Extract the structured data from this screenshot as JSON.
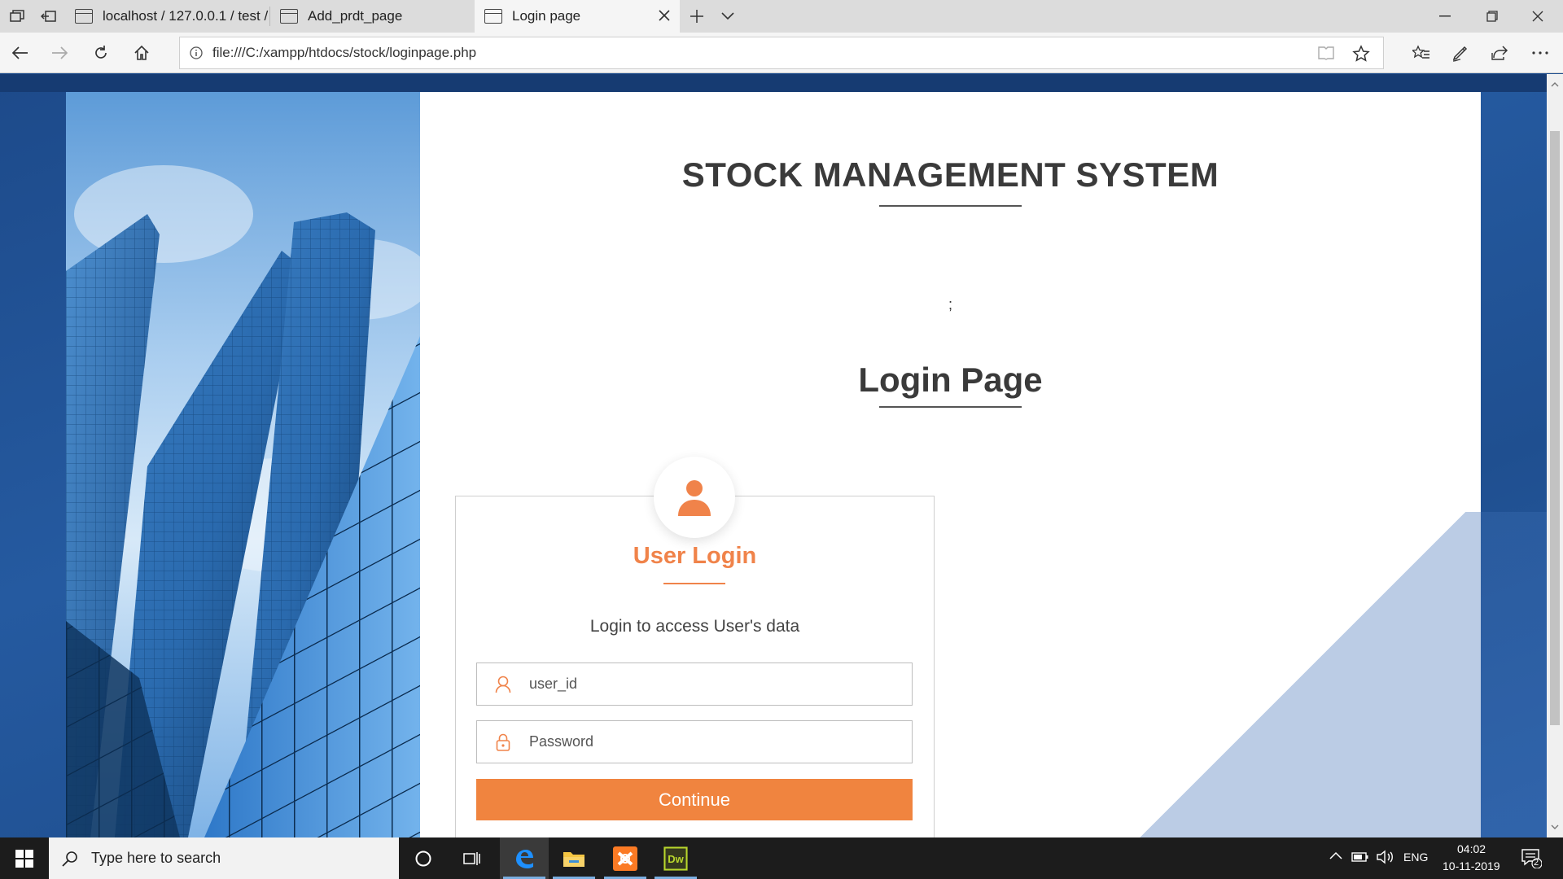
{
  "browser": {
    "tabs": [
      {
        "label": "localhost / 127.0.0.1 / test /"
      },
      {
        "label": "Add_prdt_page"
      },
      {
        "label": "Login page"
      }
    ],
    "url": "file:///C:/xampp/htdocs/stock/loginpage.php"
  },
  "page": {
    "site_title": "STOCK MANAGEMENT SYSTEM",
    "stray_text": ";",
    "heading": "Login Page",
    "login": {
      "title": "User Login",
      "subtitle": "Login to access User's data",
      "user_placeholder": "user_id",
      "password_placeholder": "Password",
      "submit_label": "Continue"
    }
  },
  "taskbar": {
    "search_placeholder": "Type here to search",
    "language": "ENG",
    "time": "04:02",
    "date": "10-11-2019",
    "notification_count": "2"
  },
  "colors": {
    "accent": "#f0843f",
    "page_background": "#1f4f8f"
  }
}
